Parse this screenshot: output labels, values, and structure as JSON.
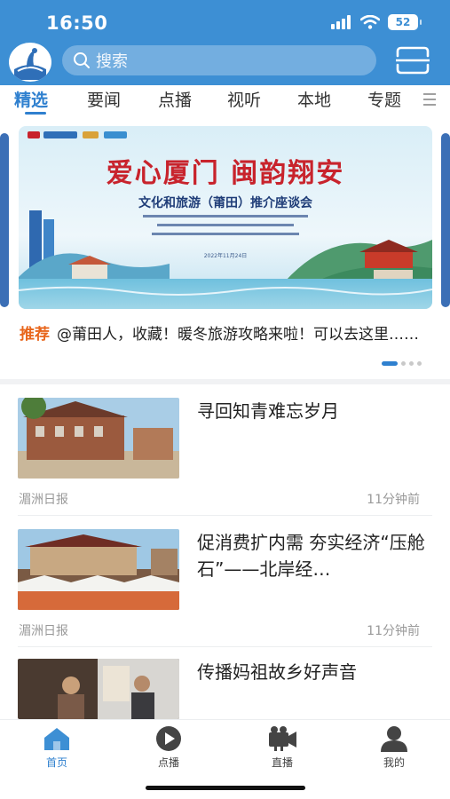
{
  "status": {
    "time": "16:50",
    "battery": "52"
  },
  "search": {
    "placeholder": "搜索"
  },
  "tabs": [
    {
      "label": "精选",
      "active": true
    },
    {
      "label": "要闻"
    },
    {
      "label": "点播"
    },
    {
      "label": "视听"
    },
    {
      "label": "本地"
    },
    {
      "label": "专题"
    }
  ],
  "banner": {
    "title": "爱心厦门 闽韵翔安",
    "subtitle": "文化和旅游（莆田）推介座谈会",
    "date": "2022年11月24日",
    "recommend_tag": "推荐",
    "recommend_text": "@莆田人，收藏！暖冬旅游攻略来啦！可以去这里……"
  },
  "news": [
    {
      "title": "寻回知青难忘岁月",
      "source": "湄洲日报",
      "time": "11分钟前"
    },
    {
      "title": "促消费扩内需 夯实经济“压舱石”——北岸经…",
      "source": "湄洲日报",
      "time": "11分钟前"
    },
    {
      "title": "传播妈祖故乡好声音",
      "source": "",
      "time": ""
    }
  ],
  "bottom_nav": [
    {
      "label": "首页",
      "icon": "home-icon",
      "active": true
    },
    {
      "label": "点播",
      "icon": "play-icon"
    },
    {
      "label": "直播",
      "icon": "camera-icon"
    },
    {
      "label": "我的",
      "icon": "user-icon"
    }
  ],
  "colors": {
    "primary": "#3d8fd4",
    "accent": "#2f80cf",
    "recommend": "#e8661c",
    "banner_title": "#c8232c"
  }
}
